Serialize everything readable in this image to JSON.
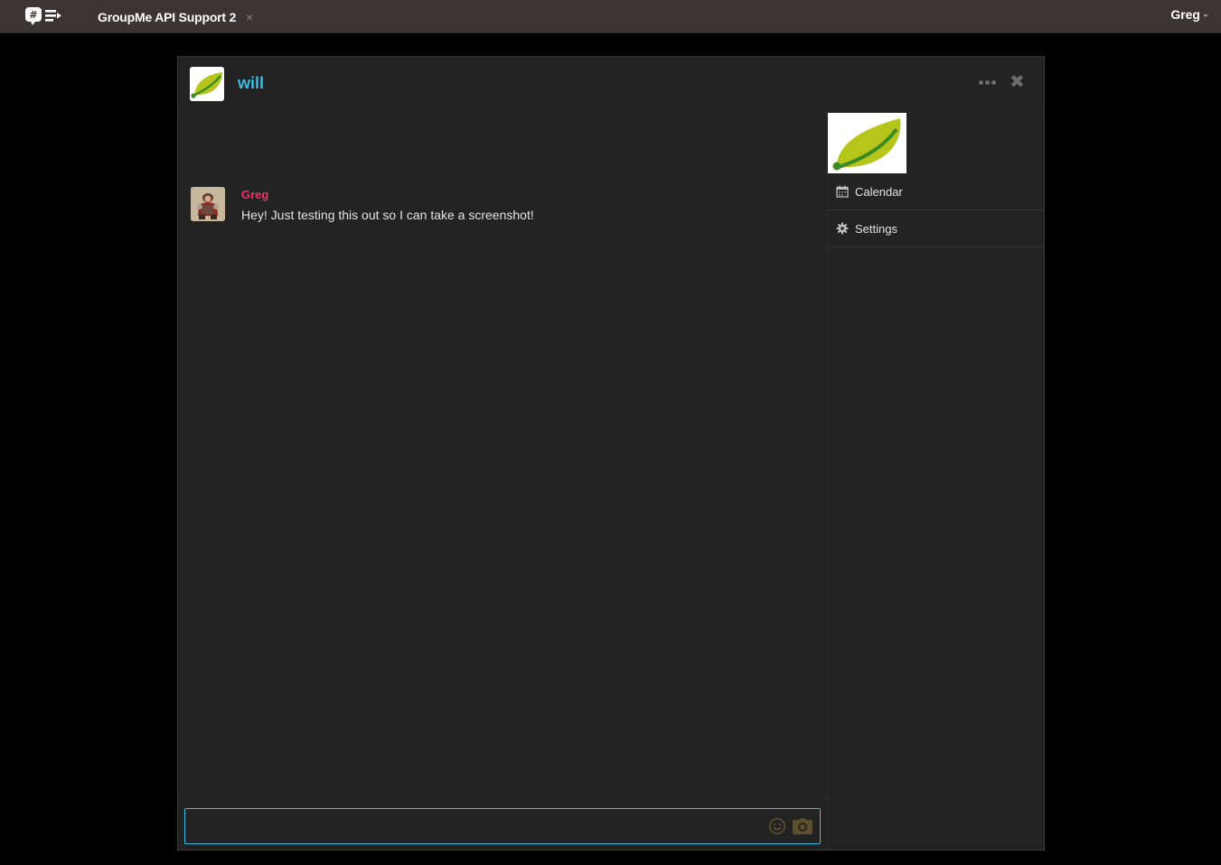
{
  "topbar": {
    "app_logo_icon": "groupme-logo-icon",
    "tab": {
      "label": "GroupMe API Support 2",
      "close_glyph": "×"
    },
    "user": {
      "name": "Greg"
    }
  },
  "chat": {
    "header": {
      "title": "will",
      "title_color": "#3fbde6",
      "more_icon": "more-dots-icon",
      "close_glyph": "✖"
    },
    "messages": [
      {
        "author": "Greg",
        "author_color": "#e8336a",
        "text": "Hey! Just testing this out so I can take a screenshot!"
      }
    ],
    "composer": {
      "value": "",
      "placeholder": "",
      "border_color": "#3fbde6",
      "emoji_icon": "emoji-smile-icon",
      "camera_icon": "camera-icon"
    }
  },
  "sidebar": {
    "items": [
      {
        "label": "Calendar",
        "icon": "calendar-icon"
      },
      {
        "label": "Settings",
        "icon": "gear-icon"
      }
    ]
  },
  "colors": {
    "topbar_bg": "#3a3434",
    "page_bg": "#000000",
    "window_bg": "#232323"
  }
}
